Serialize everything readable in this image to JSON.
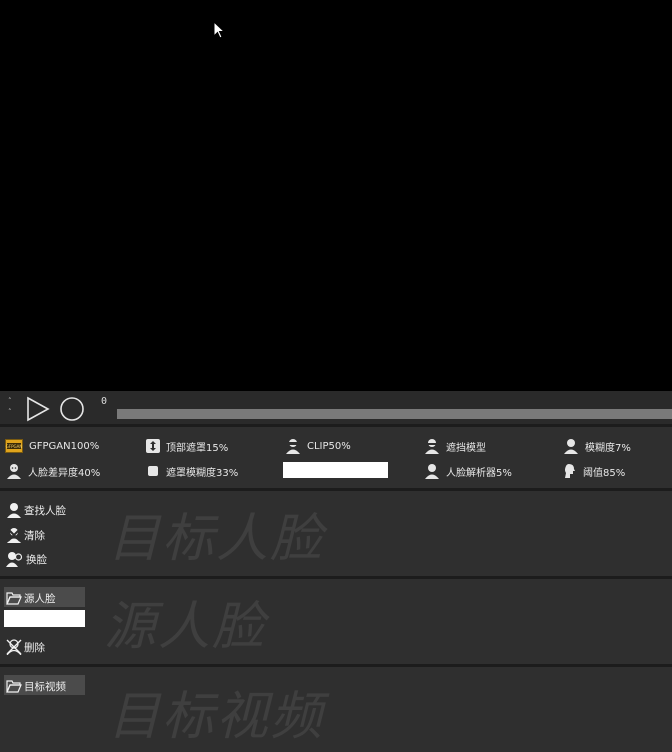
{
  "playbar": {
    "frame": "0"
  },
  "params": {
    "gfpgan_icon_text": "GFPGAN",
    "gfpgan": "GFPGAN100%",
    "top_mask": "顶部遮罩15%",
    "clip": "CLIP50%",
    "occluder": "遮挡模型",
    "blur": "模糊度7%",
    "face_diff": "人脸差异度40%",
    "mask_blur": "遮罩模糊度33%",
    "face_parser": "人脸解析器5%",
    "threshold": "阈值85%"
  },
  "target_faces": {
    "find": "查找人脸",
    "clear": "清除",
    "swap": "换脸",
    "watermark": "目标人脸"
  },
  "source_faces": {
    "button": "源人脸",
    "delete": "删除",
    "watermark": "源人脸"
  },
  "target_video": {
    "button": "目标视频",
    "watermark": "目标视频"
  }
}
